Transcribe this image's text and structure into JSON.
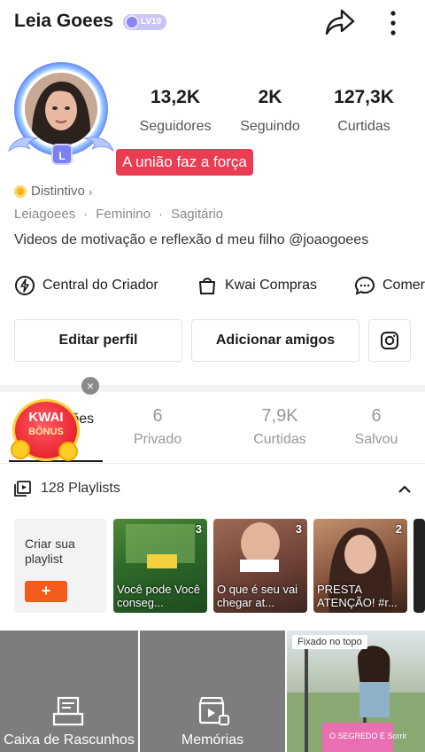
{
  "header": {
    "username": "Leia Goees",
    "level_badge": "LV10"
  },
  "stats": [
    {
      "value": "13,2K",
      "label": "Seguidores"
    },
    {
      "value": "2K",
      "label": "Seguindo"
    },
    {
      "value": "127,3K",
      "label": "Curtidas"
    }
  ],
  "avatar": {
    "level_chip": "L"
  },
  "motto": "A união faz a força",
  "badge_link": "Distintivo",
  "meta": {
    "handle": "Leiagoees",
    "gender": "Feminino",
    "sign": "Sagitário"
  },
  "bio": "Videos de motivação e reflexão d meu filho @joaogoees",
  "creator_row": {
    "creator_center": "Central do Criador",
    "kwai_shop": "Kwai Compras",
    "comments": "Comer"
  },
  "buttons": {
    "edit_profile": "Editar perfil",
    "add_friends": "Adicionar amigos"
  },
  "tabs": [
    {
      "count": "",
      "label": "Publicações"
    },
    {
      "count": "6",
      "label": "Privado"
    },
    {
      "count": "7,9K",
      "label": "Curtidas"
    },
    {
      "count": "6",
      "label": "Salvou"
    }
  ],
  "kwai_bonus": {
    "line1": "KWAI",
    "line2": "BÔNUS"
  },
  "playlists": {
    "header": "128 Playlists",
    "create_label": "Criar sua playlist",
    "create_button": "+",
    "items": [
      {
        "count": "3",
        "caption": "Você pode Você conseg..."
      },
      {
        "count": "3",
        "caption": "O que é seu vai chegar at..."
      },
      {
        "count": "2",
        "caption": "PRESTA ATENÇÃO! #r..."
      }
    ]
  },
  "bottom_grid": {
    "drafts": "Caixa de Rascunhos",
    "memories": "Memórias",
    "pinned": "Fixado no topo",
    "video_caption": "O SEGREDO É Sorrir"
  },
  "colors": {
    "accent_red": "#ea3d54",
    "orange": "#f55a1d",
    "level_purple": "#8c83ee"
  }
}
